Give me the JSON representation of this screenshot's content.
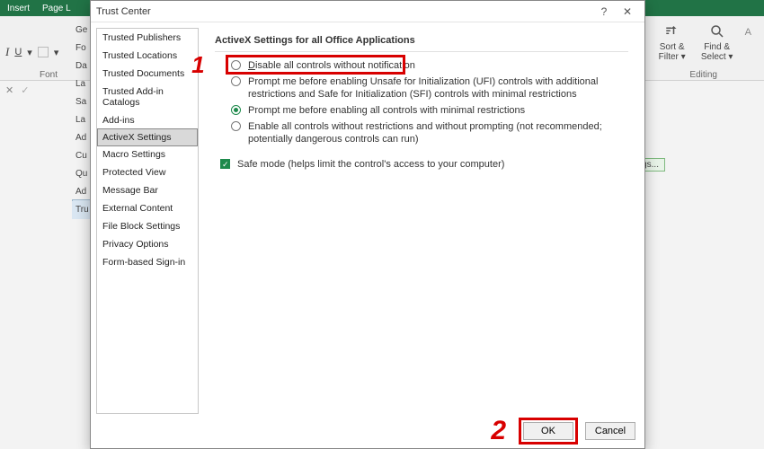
{
  "bg": {
    "tabs": [
      "Insert",
      "Page L"
    ],
    "font_group_label": "Font",
    "editing_group_label": "Editing",
    "sort_label": "Sort & Filter ▾",
    "find_label": "Find & Select ▾",
    "tag": "gs...",
    "left_items": [
      "Ge",
      "Fo",
      "Da",
      "La",
      "Sa",
      "La",
      "Ad",
      "Cu",
      "Qu",
      "Ad",
      "Tru"
    ],
    "formula_x": "✕",
    "formula_check": "✓"
  },
  "dialog": {
    "title": "Trust Center",
    "help_glyph": "?",
    "close_glyph": "✕",
    "sidebar": {
      "items": [
        "Trusted Publishers",
        "Trusted Locations",
        "Trusted Documents",
        "Trusted Add-in Catalogs",
        "Add-ins",
        "ActiveX Settings",
        "Macro Settings",
        "Protected View",
        "Message Bar",
        "External Content",
        "File Block Settings",
        "Privacy Options",
        "Form-based Sign-in"
      ],
      "selected_index": 5
    },
    "section_title": "ActiveX Settings for all Office Applications",
    "options": [
      {
        "label": "Disable all controls without notification",
        "checked": false
      },
      {
        "label": "Prompt me before enabling Unsafe for Initialization (UFI) controls with additional restrictions and Safe for Initialization (SFI) controls with minimal restrictions",
        "checked": false
      },
      {
        "label": "Prompt me before enabling all controls with minimal restrictions",
        "checked": true
      },
      {
        "label": "Enable all controls without restrictions and without prompting (not recommended; potentially dangerous controls can run)",
        "checked": false
      }
    ],
    "safe_mode": {
      "label": "Safe mode (helps limit the control's access to your computer)",
      "checked": true
    },
    "ok_label": "OK",
    "cancel_label": "Cancel",
    "annotation1": "1",
    "annotation2": "2"
  }
}
